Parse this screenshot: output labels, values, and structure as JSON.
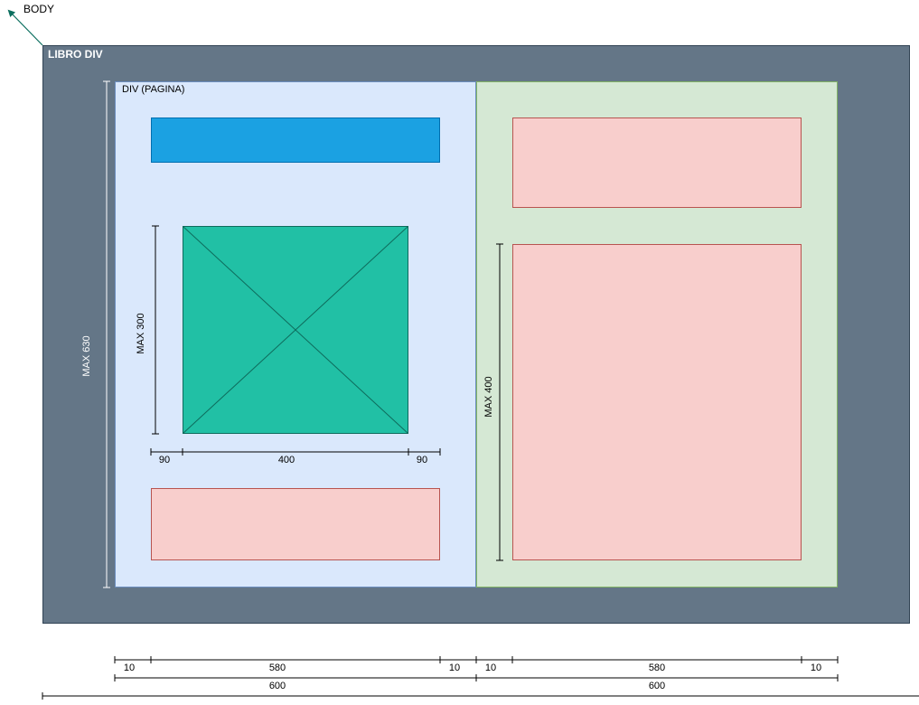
{
  "labels": {
    "body": "BODY",
    "libro": "LIBRO DIV",
    "pagina": "DIV (PAGINA)"
  },
  "dimensions": {
    "max_630": "MAX 630",
    "max_300": "MAX 300",
    "max_400": "MAX 400",
    "image_left_margin": "90",
    "image_width": "400",
    "image_right_margin": "90",
    "left_page_margin_left": "10",
    "left_page_content": "580",
    "left_page_margin_right": "10",
    "right_page_margin_left": "10",
    "right_page_content": "580",
    "right_page_margin_right": "10",
    "left_page_width": "600",
    "right_page_width": "600"
  },
  "colors": {
    "libro_fill": "#647687",
    "left_page_fill": "#dae8fc",
    "right_page_fill": "#d5e8d4",
    "header_bar_fill": "#1ba1e2",
    "image_fill": "#21c0a5",
    "block_fill": "#f8cecc",
    "body_arrow": "#0b6e5e"
  }
}
